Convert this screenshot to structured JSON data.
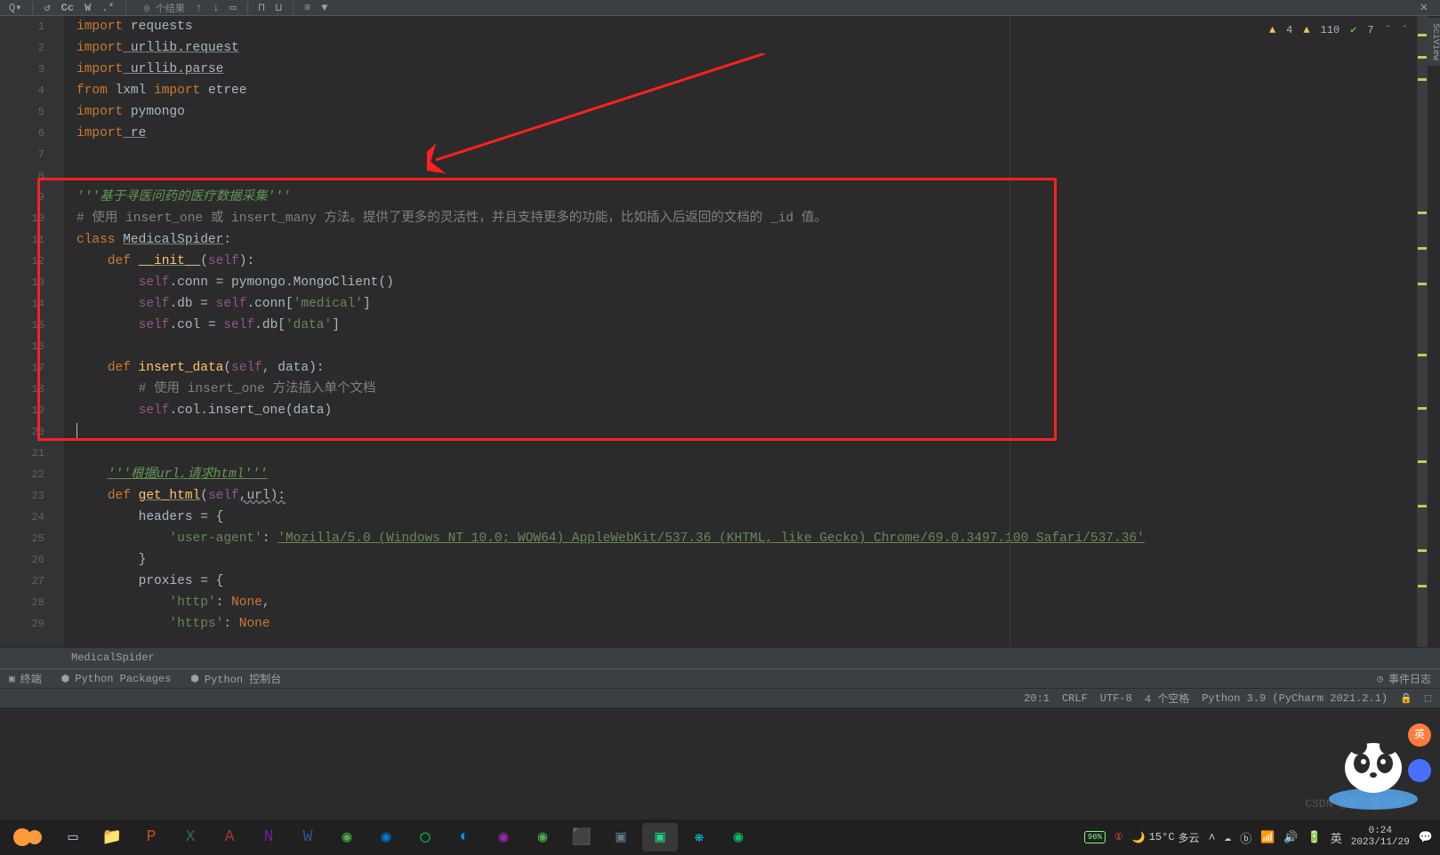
{
  "toolbar": {
    "results": "0 个结果",
    "cc": "Cc",
    "w": "W"
  },
  "warnings": {
    "a": "4",
    "b": "110",
    "checks": "7"
  },
  "sciview": "SciView",
  "code": {
    "l1_kw": "import",
    "l1_id": " requests",
    "l2_kw": "import",
    "l2_id": " urllib.request",
    "l3_kw": "import",
    "l3_id": " urllib.parse",
    "l4_a": "from",
    "l4_b": " lxml ",
    "l4_c": "import",
    "l4_d": " etree",
    "l5_kw": "import",
    "l5_id": " pymongo",
    "l6_kw": "import",
    "l6_id": " re",
    "l9": "'''基于寻医问药的医疗数据采集'''",
    "l10": "# 使用 insert_one 或 insert_many 方法。提供了更多的灵活性，并且支持更多的功能，比如插入后返回的文档的 _id 值。",
    "l11_a": "class",
    "l11_b": "MedicalSpider",
    "l12_a": "def ",
    "l12_b": "__init__",
    "l12_c": "self",
    "l13_a": "self",
    "l13_b": ".conn = pymongo.MongoClient()",
    "l14_a": "self",
    "l14_b": ".db = ",
    "l14_c": "self",
    "l14_d": ".conn[",
    "l14_e": "'medical'",
    "l14_f": "]",
    "l15_a": "self",
    "l15_b": ".col = ",
    "l15_c": "self",
    "l15_d": ".db[",
    "l15_e": "'data'",
    "l15_f": "]",
    "l17_a": "def ",
    "l17_b": "insert_data",
    "l17_c": "self",
    "l17_d": ", data):",
    "l18": "# 使用 insert_one 方法插入单个文档",
    "l19_a": "self",
    "l19_b": ".col.insert_one(data)",
    "l22": "'''根据url,请求html'''",
    "l23_a": "def ",
    "l23_b": "get_html",
    "l23_c": "self",
    "l23_d": ",url):",
    "l24": "headers = {",
    "l25_a": "'user-agent'",
    "l25_b": ": ",
    "l25_c": "'Mozilla/5.0 (Windows NT 10.0; WOW64) AppleWebKit/537.36 (KHTML, like Gecko) Chrome/69.0.3497.100 Safari/537.36'",
    "l26": "}",
    "l27": "proxies = {",
    "l28_a": "'http'",
    "l28_b": ": ",
    "l28_c": "None",
    "l28_d": ",",
    "l29_a": "'https'",
    "l29_b": ": ",
    "l29_c": "None"
  },
  "breadcrumb": "MedicalSpider",
  "bottom_tabs": {
    "terminal": "终端",
    "packages": "Python Packages",
    "console": "Python 控制台",
    "events": "事件日志"
  },
  "status": {
    "pos": "20:1",
    "eol": "CRLF",
    "enc": "UTF-8",
    "indent": "4 个空格",
    "interp": "Python 3.9 (PyCharm 2021.2.1)"
  },
  "taskbar": {
    "weather_temp": "15°C",
    "weather_desc": "多云",
    "battery": "96%",
    "time": "0:24",
    "date": "2023/11/29"
  },
  "watermark": "CSDN @星川皆无恙"
}
